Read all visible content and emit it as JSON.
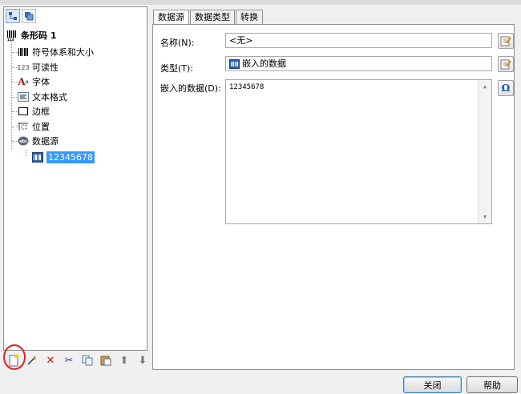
{
  "tree": {
    "root_label": "条形码 1",
    "items": [
      {
        "label": "符号体系和大小",
        "icon": "barcode-icon"
      },
      {
        "label": "可读性",
        "icon": "readable-123-icon"
      },
      {
        "label": "字体",
        "icon": "font-icon"
      },
      {
        "label": "文本格式",
        "icon": "text-format-icon"
      },
      {
        "label": "边框",
        "icon": "border-icon"
      },
      {
        "label": "位置",
        "icon": "position-icon"
      },
      {
        "label": "数据源",
        "icon": "datasource-icon"
      }
    ],
    "leaf": {
      "label": "12345678",
      "icon": "embedded-data-icon"
    }
  },
  "tabs": [
    {
      "label": "数据源"
    },
    {
      "label": "数据类型"
    },
    {
      "label": "转换"
    }
  ],
  "form": {
    "name_label": "名称(N):",
    "name_value": "<无>",
    "type_label": "类型(T):",
    "type_value": "嵌入的数据",
    "data_label": "嵌入的数据(D):",
    "data_value": "12345678"
  },
  "buttons": {
    "close": "关闭",
    "help": "帮助"
  },
  "colors": {
    "selection": "#3399ff",
    "highlight_circle": "#e02020"
  }
}
